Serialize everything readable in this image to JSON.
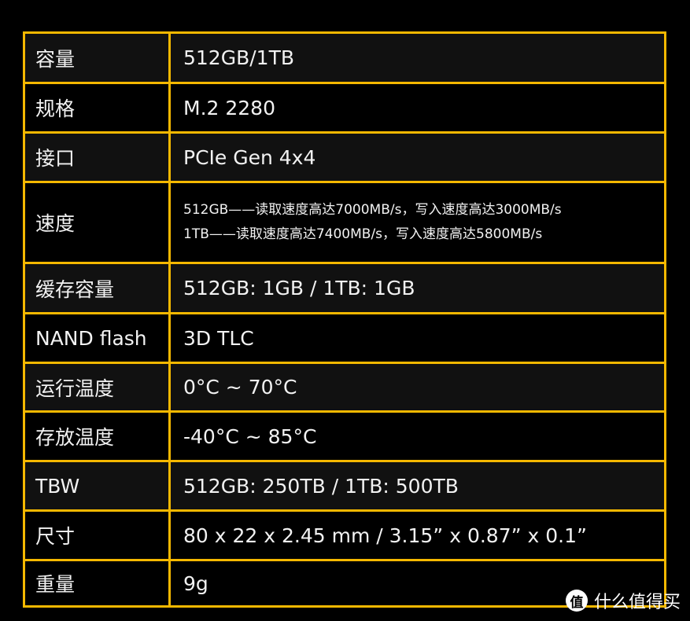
{
  "specs": [
    {
      "label": "容量",
      "value": "512GB/1TB"
    },
    {
      "label": "规格",
      "value": "M.2 2280"
    },
    {
      "label": "接口",
      "value": "PCIe Gen 4x4"
    },
    {
      "label": "速度",
      "lines": [
        "512GB——读取速度高达7000MB/s，写入速度高达3000MB/s",
        "1TB——读取速度高达7400MB/s，写入速度高达5800MB/s"
      ]
    },
    {
      "label": "缓存容量",
      "value": "512GB: 1GB / 1TB: 1GB"
    },
    {
      "label": "NAND flash",
      "value": "3D TLC"
    },
    {
      "label": "运行温度",
      "value": "0°C ~ 70°C"
    },
    {
      "label": "存放温度",
      "value": "-40°C ~ 85°C"
    },
    {
      "label": "TBW",
      "value": "512GB: 250TB / 1TB: 500TB"
    },
    {
      "label": "尺寸",
      "value": "80 x 22 x 2.45 mm / 3.15”  x 0.87”  x 0.1”"
    },
    {
      "label": "重量",
      "value": "9g"
    }
  ],
  "watermark": {
    "icon_text": "值",
    "text": "什么值得买"
  },
  "colors": {
    "border": "#f5b800",
    "background": "#000000",
    "row_alt": "#111111"
  }
}
